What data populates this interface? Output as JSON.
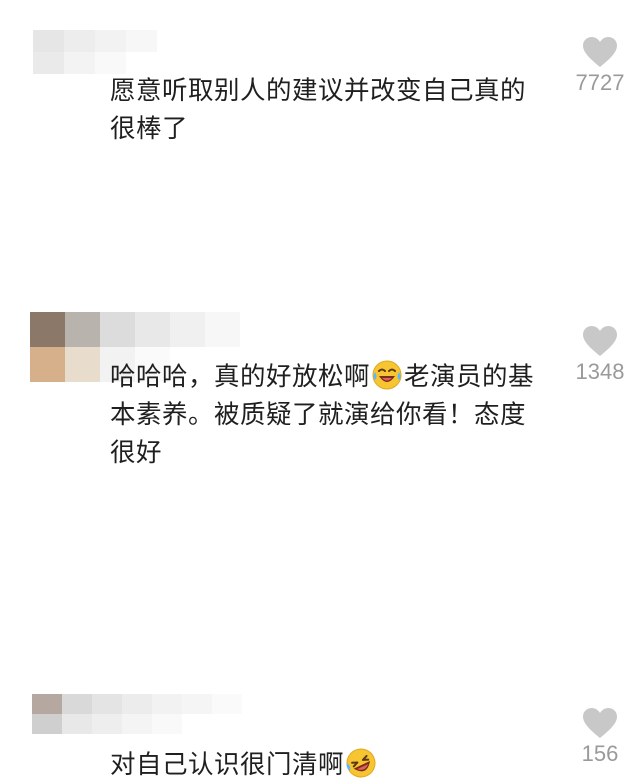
{
  "comments": [
    {
      "text": "愿意听取别人的建议并改变自己真的很棒了",
      "likes": "7727",
      "avatar_icon": "blurred-avatar"
    },
    {
      "text_before_emoji": "哈哈哈，真的好放松啊",
      "emoji_icon": "laughing-tears-emoji",
      "text_after_emoji": "老演员的基本素养。被质疑了就演给你看！态度很好",
      "likes": "1348",
      "avatar_icon": "blurred-avatar"
    },
    {
      "text": "对自己认识很门清啊",
      "emoji_icon": "rolling-laughing-emoji",
      "likes": "156",
      "avatar_icon": "blurred-avatar"
    }
  ],
  "like_icon": "heart-icon",
  "colors": {
    "text": "#1f1f1f",
    "count": "#9a9a9a",
    "heart": "#c8c8c8",
    "emoji_face": "#f7c531"
  }
}
